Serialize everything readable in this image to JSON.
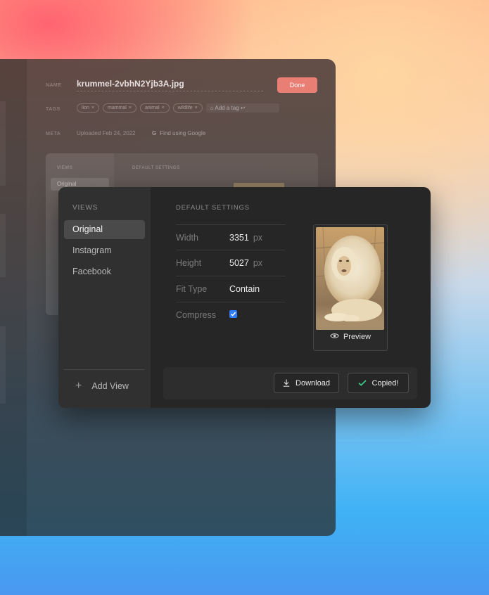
{
  "back_window": {
    "name_label": "NAME",
    "filename": "krummel-2vbhN2Yjb3A.jpg",
    "done_label": "Done",
    "tags_label": "TAGS",
    "tags": [
      "lion",
      "mammal",
      "animal",
      "wildlife"
    ],
    "add_tag_placeholder": "Add a tag ↩",
    "meta_label": "META",
    "uploaded_text": "Uploaded Feb 24, 2022",
    "google_text": "Find using Google",
    "views_label": "VIEWS",
    "original_label": "Original",
    "default_settings_label": "DEFAULT SETTINGS"
  },
  "dialog": {
    "sidebar": {
      "views_label": "VIEWS",
      "items": [
        {
          "label": "Original",
          "active": true
        },
        {
          "label": "Instagram",
          "active": false
        },
        {
          "label": "Facebook",
          "active": false
        }
      ],
      "add_view_label": "Add View"
    },
    "main": {
      "default_settings_label": "DEFAULT SETTINGS",
      "width": {
        "label": "Width",
        "value": "3351",
        "unit": "px"
      },
      "height": {
        "label": "Height",
        "value": "5027",
        "unit": "px"
      },
      "fit_type": {
        "label": "Fit Type",
        "value": "Contain"
      },
      "compress": {
        "label": "Compress",
        "checked": true
      },
      "preview_label": "Preview"
    },
    "footer": {
      "download_label": "Download",
      "copied_label": "Copied!"
    }
  },
  "colors": {
    "accent_done": "#e87a73",
    "checkbox_blue": "#2f7cf6",
    "copied_check": "#3ecf8e"
  },
  "icons": [
    "plus-icon",
    "eye-icon",
    "download-icon",
    "check-icon",
    "tag-icon",
    "google-icon",
    "close-icon"
  ]
}
